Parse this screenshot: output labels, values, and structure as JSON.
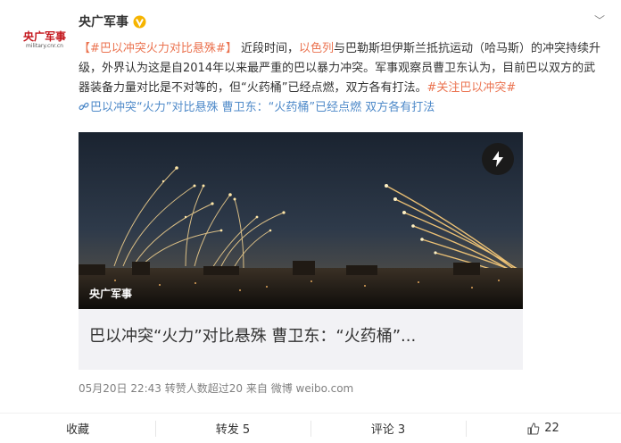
{
  "avatar": {
    "logo_main": "央广军事",
    "logo_sub": "military.cnr.cn"
  },
  "author": {
    "name": "央广军事",
    "verified_icon": "verified-v-icon",
    "verified_color": "#f6b400"
  },
  "more": {
    "icon": "chevron-down-icon",
    "label": "﹀"
  },
  "post": {
    "prefix": "【",
    "topic_tag": "#巴以冲突火力对比悬殊#",
    "bracket_close": "】",
    "text_1": " 近段时间，",
    "link_israel": "以色列",
    "text_2": "与巴勒斯坦伊斯兰抵抗运动（哈马斯）的冲突持续升级，外界认为这是自2014年以来最严重的巴以暴力冲突。军事观察员曹卫东认为，目前巴以双方的武器装备力量对比是不对等的，但“火药桶”已经点燃，双方各有打法。",
    "topic_follow": "#关注巴以冲突#",
    "link_icon": "link-icon",
    "link_text": "巴以冲突“火力”对比悬殊 曹卫东：“火药桶”已经点燃 双方各有打法"
  },
  "card": {
    "title": "巴以冲突“火力”对比悬殊 曹卫东：“火药桶”...",
    "brand": "央广军事",
    "flash_icon": "lightning-icon"
  },
  "meta": {
    "time": "05月20日 22:43",
    "forward_note": "转赞人数超过20",
    "source": "来自 微博 weibo.com"
  },
  "actions": {
    "favorite": "收藏",
    "forward": "转发 5",
    "comment": "评论 3",
    "like_icon": "thumbs-up-icon",
    "like": "22"
  },
  "colors": {
    "topic": "#eb7350",
    "link": "#4f8ac9",
    "brand_red": "#c4161c"
  }
}
